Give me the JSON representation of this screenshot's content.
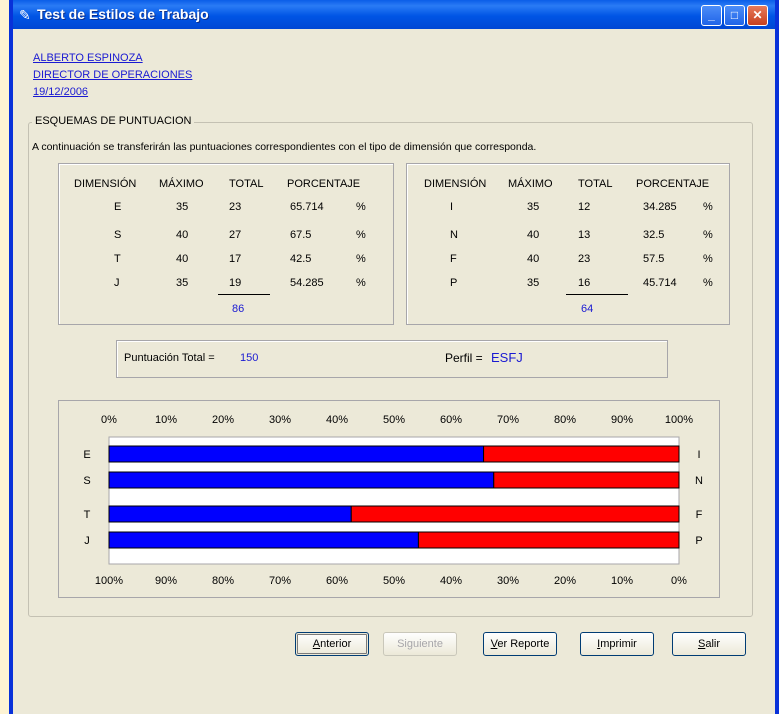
{
  "window": {
    "title": "Test de Estilos de Trabajo"
  },
  "header": {
    "name": "ALBERTO ESPINOZA",
    "position": "DIRECTOR DE OPERACIONES",
    "date": "19/12/2006"
  },
  "group": {
    "legend": "ESQUEMAS DE PUNTUACION",
    "instructions": "A continuación se transferirán las puntuaciones correspondientes con el tipo de dimensión que corresponda."
  },
  "left_table": {
    "headers": [
      "DIMENSIÓN",
      "MÁXIMO",
      "TOTAL",
      "PORCENTAJE"
    ],
    "rows": [
      {
        "dim": "E",
        "max": "35",
        "total": "23",
        "pct": "65.714",
        "sym": "%"
      },
      {
        "dim": "S",
        "max": "40",
        "total": "27",
        "pct": "67.5",
        "sym": "%"
      },
      {
        "dim": "T",
        "max": "40",
        "total": "17",
        "pct": "42.5",
        "sym": "%"
      },
      {
        "dim": "J",
        "max": "35",
        "total": "19",
        "pct": "54.285",
        "sym": "%"
      }
    ],
    "sum": "86"
  },
  "right_table": {
    "headers": [
      "DIMENSIÓN",
      "MÁXIMO",
      "TOTAL",
      "PORCENTAJE"
    ],
    "rows": [
      {
        "dim": "I",
        "max": "35",
        "total": "12",
        "pct": "34.285",
        "sym": "%"
      },
      {
        "dim": "N",
        "max": "40",
        "total": "13",
        "pct": "32.5",
        "sym": "%"
      },
      {
        "dim": "F",
        "max": "40",
        "total": "23",
        "pct": "57.5",
        "sym": "%"
      },
      {
        "dim": "P",
        "max": "35",
        "total": "16",
        "pct": "45.714",
        "sym": "%"
      }
    ],
    "sum": "64"
  },
  "summary": {
    "total_label": "Puntuación Total =",
    "total_value": "150",
    "perfil_label": "Perfil =",
    "perfil_value": "ESFJ"
  },
  "chart_data": {
    "type": "bar",
    "orientation": "horizontal-stacked",
    "top_axis_ticks": [
      "0%",
      "10%",
      "20%",
      "30%",
      "40%",
      "50%",
      "60%",
      "70%",
      "80%",
      "90%",
      "100%"
    ],
    "bottom_axis_ticks": [
      "100%",
      "90%",
      "80%",
      "70%",
      "60%",
      "50%",
      "40%",
      "30%",
      "20%",
      "10%",
      "0%"
    ],
    "left_labels": [
      "E",
      "S",
      "T",
      "J"
    ],
    "right_labels": [
      "I",
      "N",
      "F",
      "P"
    ],
    "series": [
      {
        "values": [
          65.714,
          67.5,
          42.5,
          54.285
        ],
        "color": "#0000ff"
      },
      {
        "values": [
          34.285,
          32.5,
          57.5,
          45.714
        ],
        "color": "#ff0000"
      }
    ],
    "xlim": [
      0,
      100
    ]
  },
  "buttons": {
    "anterior": {
      "accel": "A",
      "rest": "nterior"
    },
    "siguiente": {
      "label": "Siguiente"
    },
    "ver_reporte": {
      "accel": "V",
      "rest": "er Reporte"
    },
    "imprimir": {
      "accel": "I",
      "rest": "mprimir"
    },
    "salir": {
      "accel": "S",
      "rest": "alir"
    }
  },
  "colors": {
    "accent_blue": "#1a1ad2",
    "bar_blue": "#0000ff",
    "bar_red": "#ff0000",
    "window_bg": "#ece9d8"
  }
}
